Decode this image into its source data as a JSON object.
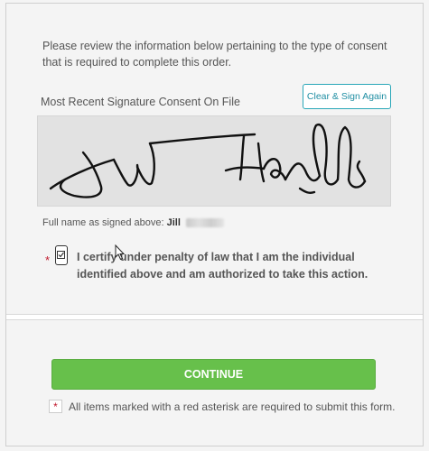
{
  "consent": {
    "intro_text": "Please review the information below pertaining to the type of consent that is required to complete this order.",
    "signature_label": "Most Recent Signature Consent On File",
    "clear_sign_button": "Clear & Sign Again",
    "full_name_label": "Full name as signed above:",
    "full_name_value": "Jill",
    "required_marker": "*",
    "certify_text": "I certify under penalty of law that I am the individual identified above and am authorized to take this action.",
    "certify_checked": true
  },
  "footer": {
    "continue_button": "CONTINUE",
    "required_note": "All items marked with a red asterisk are required to submit this form.",
    "required_marker": "*"
  },
  "colors": {
    "accent_teal": "#2aa7b8",
    "continue_green": "#67c04b",
    "required_red": "#c0182c"
  }
}
